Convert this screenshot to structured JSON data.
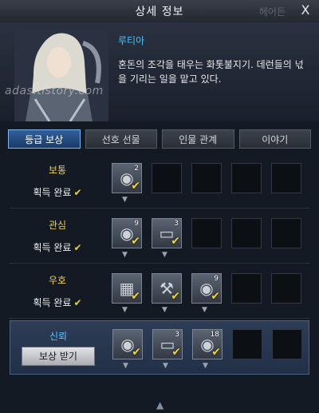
{
  "window": {
    "title": "상세 정보",
    "ghost_tab": "헤어든",
    "close_label": "X"
  },
  "character": {
    "name": "루티아",
    "description": "혼돈의 조각을 태우는 화톳불지기. 데런들의 넋을 기리는 일을 맡고 있다.",
    "watermark": "adas.tistory.com"
  },
  "tabs": [
    {
      "label": "등급 보상",
      "active": true
    },
    {
      "label": "선호 선물",
      "active": false
    },
    {
      "label": "인물 관계",
      "active": false
    },
    {
      "label": "이야기",
      "active": false
    }
  ],
  "tiers": [
    {
      "name": "보통",
      "status": "획득 완료",
      "completed": true,
      "claim_label": "",
      "rewards": [
        {
          "icon": "coin-icon",
          "count": "2",
          "claimed": true
        },
        {
          "empty": true
        },
        {
          "empty": true
        },
        {
          "empty": true
        },
        {
          "empty": true
        }
      ]
    },
    {
      "name": "관심",
      "status": "획득 완료",
      "completed": true,
      "claim_label": "",
      "rewards": [
        {
          "icon": "coin-icon",
          "count": "9",
          "claimed": true
        },
        {
          "icon": "scroll-icon",
          "count": "3",
          "claimed": true
        },
        {
          "empty": true
        },
        {
          "empty": true
        },
        {
          "empty": true
        }
      ]
    },
    {
      "name": "우호",
      "status": "획득 완료",
      "completed": true,
      "claim_label": "",
      "rewards": [
        {
          "icon": "card-icon",
          "count": "",
          "claimed": true
        },
        {
          "icon": "hammer-icon",
          "count": "",
          "claimed": true
        },
        {
          "icon": "coin-icon",
          "count": "9",
          "claimed": true
        },
        {
          "empty": true
        },
        {
          "empty": true
        }
      ]
    },
    {
      "name": "신뢰",
      "status": "",
      "completed": false,
      "claim_label": "보상 받기",
      "rewards": [
        {
          "icon": "coin-icon",
          "count": "",
          "claimed": true
        },
        {
          "icon": "scroll-icon",
          "count": "3",
          "claimed": true
        },
        {
          "icon": "coin-icon",
          "count": "18",
          "claimed": true
        },
        {
          "empty": true
        },
        {
          "empty": true
        }
      ]
    }
  ]
}
